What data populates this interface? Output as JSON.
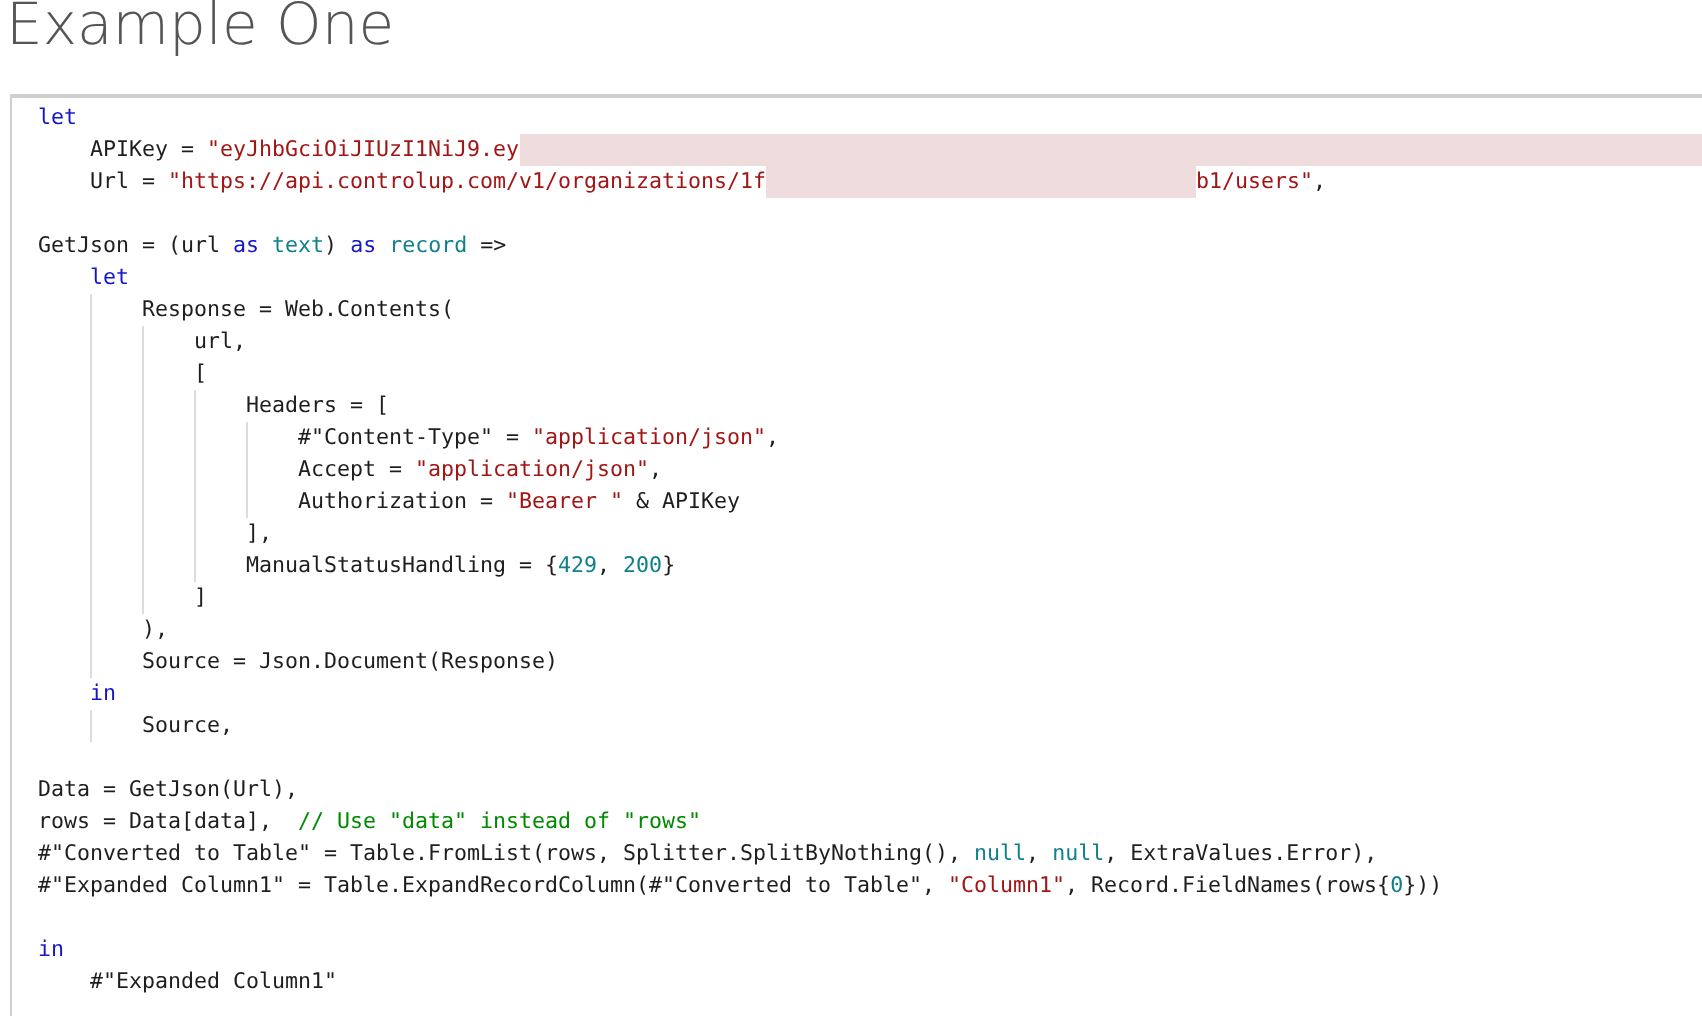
{
  "title": "Example One",
  "editor": {
    "lines": [
      {
        "kind": "code",
        "tokens": [
          {
            "kind": "keyword",
            "text": "let"
          }
        ],
        "children": [
          {
            "kind": "code",
            "tokens": [
              {
                "kind": "plain",
                "text": "APIKey = "
              },
              {
                "kind": "string",
                "text": "\"eyJhbGciOiJIUzI1NiJ9.ey"
              },
              {
                "kind": "redacted"
              }
            ]
          },
          {
            "kind": "code",
            "tokens": [
              {
                "kind": "plain",
                "text": "Url = "
              },
              {
                "kind": "string",
                "text": "\"https://api.controlup.com/v1/organizations/1f"
              },
              {
                "kind": "redacted"
              },
              {
                "kind": "string",
                "text": "b1/users\""
              },
              {
                "kind": "plain",
                "text": ","
              }
            ]
          }
        ]
      },
      {
        "kind": "blank"
      },
      {
        "kind": "code",
        "tokens": [
          {
            "kind": "plain",
            "text": "GetJson = (url "
          },
          {
            "kind": "keyword",
            "text": "as"
          },
          {
            "kind": "type",
            "text": " text"
          },
          {
            "kind": "plain",
            "text": ") "
          },
          {
            "kind": "keyword",
            "text": "as"
          },
          {
            "kind": "type",
            "text": " record"
          },
          {
            "kind": "plain",
            "text": " =>"
          }
        ],
        "children": [
          {
            "kind": "code",
            "tokens": [
              {
                "kind": "keyword",
                "text": "let"
              }
            ],
            "children": [
              {
                "kind": "code",
                "tokens": [
                  {
                    "kind": "plain",
                    "text": "Response = Web.Contents("
                  }
                ],
                "children": [
                  {
                    "kind": "code",
                    "tokens": [
                      {
                        "kind": "plain",
                        "text": "url,"
                      }
                    ]
                  },
                  {
                    "kind": "code",
                    "tokens": [
                      {
                        "kind": "plain",
                        "text": "["
                      }
                    ],
                    "children": [
                      {
                        "kind": "code",
                        "tokens": [
                          {
                            "kind": "plain",
                            "text": "Headers = ["
                          }
                        ],
                        "children": [
                          {
                            "kind": "code",
                            "tokens": [
                              {
                                "kind": "plain",
                                "text": "#\"Content-Type\" = "
                              },
                              {
                                "kind": "string",
                                "text": "\"application/json\""
                              },
                              {
                                "kind": "plain",
                                "text": ","
                              }
                            ]
                          },
                          {
                            "kind": "code",
                            "tokens": [
                              {
                                "kind": "plain",
                                "text": "Accept = "
                              },
                              {
                                "kind": "string",
                                "text": "\"application/json\""
                              },
                              {
                                "kind": "plain",
                                "text": ","
                              }
                            ]
                          },
                          {
                            "kind": "code",
                            "tokens": [
                              {
                                "kind": "plain",
                                "text": "Authorization = "
                              },
                              {
                                "kind": "string",
                                "text": "\"Bearer \""
                              },
                              {
                                "kind": "plain",
                                "text": " & APIKey"
                              }
                            ]
                          }
                        ]
                      },
                      {
                        "kind": "code",
                        "tokens": [
                          {
                            "kind": "plain",
                            "text": "],"
                          }
                        ]
                      },
                      {
                        "kind": "code",
                        "tokens": [
                          {
                            "kind": "plain",
                            "text": "ManualStatusHandling = {"
                          },
                          {
                            "kind": "number",
                            "text": "429"
                          },
                          {
                            "kind": "plain",
                            "text": ", "
                          },
                          {
                            "kind": "number",
                            "text": "200"
                          },
                          {
                            "kind": "plain",
                            "text": "}"
                          }
                        ]
                      }
                    ]
                  },
                  {
                    "kind": "code",
                    "tokens": [
                      {
                        "kind": "plain",
                        "text": "]"
                      }
                    ]
                  }
                ]
              },
              {
                "kind": "code",
                "tokens": [
                  {
                    "kind": "plain",
                    "text": "),"
                  }
                ]
              },
              {
                "kind": "code",
                "tokens": [
                  {
                    "kind": "plain",
                    "text": "Source = Json.Document(Response)"
                  }
                ]
              }
            ]
          },
          {
            "kind": "code",
            "tokens": [
              {
                "kind": "keyword",
                "text": "in"
              }
            ],
            "children": [
              {
                "kind": "code",
                "tokens": [
                  {
                    "kind": "plain",
                    "text": "Source,"
                  }
                ]
              }
            ]
          }
        ]
      },
      {
        "kind": "blank"
      },
      {
        "kind": "code",
        "tokens": [
          {
            "kind": "plain",
            "text": "Data = GetJson(Url),"
          }
        ]
      },
      {
        "kind": "code",
        "tokens": [
          {
            "kind": "plain",
            "text": "rows = Data[data],  "
          },
          {
            "kind": "comment",
            "text": "// Use \"data\" instead of \"rows\""
          }
        ]
      },
      {
        "kind": "code",
        "tokens": [
          {
            "kind": "plain",
            "text": "#\"Converted to Table\" = Table.FromList(rows, Splitter.SplitByNothing(), "
          },
          {
            "kind": "type",
            "text": "null"
          },
          {
            "kind": "plain",
            "text": ", "
          },
          {
            "kind": "type",
            "text": "null"
          },
          {
            "kind": "plain",
            "text": ", ExtraValues.Error),"
          }
        ]
      },
      {
        "kind": "code",
        "tokens": [
          {
            "kind": "plain",
            "text": "#\"Expanded Column1\" = Table.ExpandRecordColumn(#\"Converted to Table\", "
          },
          {
            "kind": "string",
            "text": "\"Column1\""
          },
          {
            "kind": "plain",
            "text": ", Record.FieldNames(rows{"
          },
          {
            "kind": "number",
            "text": "0"
          },
          {
            "kind": "plain",
            "text": "}))"
          }
        ]
      },
      {
        "kind": "blank"
      },
      {
        "kind": "code",
        "tokens": [
          {
            "kind": "keyword",
            "text": "in"
          }
        ],
        "children": [
          {
            "kind": "code",
            "tokens": [
              {
                "kind": "plain",
                "text": "#\"Expanded Column1\""
              }
            ]
          }
        ]
      }
    ]
  }
}
